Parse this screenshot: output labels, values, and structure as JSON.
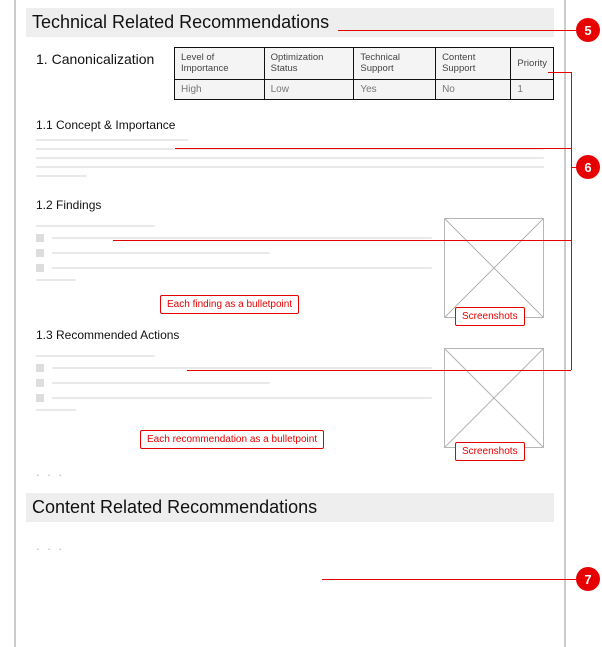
{
  "sections": {
    "technical": {
      "title": "Technical Related Recommendations"
    },
    "content": {
      "title": "Content Related Recommendations"
    }
  },
  "item": {
    "number": "1.",
    "name": "Canonicalization",
    "sub_concept": "1.1 Concept & Importance",
    "sub_findings": "1.2 Findings",
    "sub_actions": "1.3 Recommended Actions"
  },
  "table": {
    "headers": {
      "importance": "Level of Importance",
      "status": "Optimization Status",
      "tech": "Technical Support",
      "content_sup": "Content Support",
      "priority": "Priority"
    },
    "row": {
      "importance": "High",
      "status": "Low",
      "tech": "Yes",
      "content_sup": "No",
      "priority": "1"
    }
  },
  "annotations": {
    "a5": "5",
    "a6": "6",
    "a7": "7",
    "findings_label": "Each finding as a bulletpoint",
    "actions_label": "Each recommendation as a bulletpoint",
    "screenshots": "Screenshots"
  },
  "ellipsis": ". . ."
}
